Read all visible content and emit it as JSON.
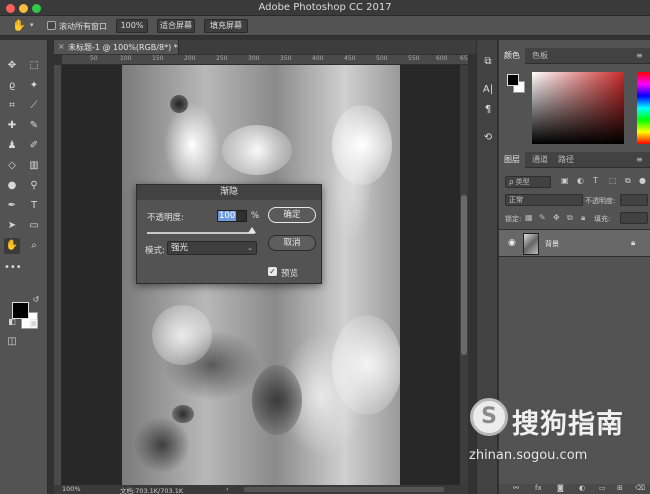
{
  "window": {
    "title": "Adobe Photoshop CC 2017"
  },
  "options": {
    "scroll_all_label": "滚动所有窗口",
    "btn_100": "100%",
    "btn_fit": "适合屏幕",
    "btn_fill": "填充屏幕"
  },
  "document": {
    "tab_close": "×",
    "tab_name": "未标题-1 @ 100%(RGB/8*) *"
  },
  "ruler": {
    "ticks": [
      "50",
      "100",
      "150",
      "200",
      "250",
      "300",
      "350",
      "400",
      "450",
      "500",
      "550",
      "600",
      "650"
    ]
  },
  "status": {
    "zoom": "100%",
    "doc": "文档:703.1K/703.1K",
    "caret": "›"
  },
  "color_panel": {
    "tab_color": "颜色",
    "tab_swatches": "色板"
  },
  "layers_panel": {
    "tab_layers": "图层",
    "tab_channels": "通道",
    "tab_paths": "路径",
    "filter_kind": "ρ 类型",
    "blend_mode": "正常",
    "opacity_label": "不透明度:",
    "lock_label": "锁定:",
    "fill_label": "填充:",
    "layer_name": "背景"
  },
  "dialog": {
    "title": "渐隐",
    "opacity_label": "不透明度:",
    "opacity_value": "100",
    "percent": "%",
    "mode_label": "模式:",
    "mode_value": "强光",
    "ok": "确定",
    "cancel": "取消",
    "preview_label": "预览"
  },
  "watermark": {
    "text": "搜狗指南",
    "url": "zhinan.sogou.com"
  },
  "colors": {
    "foreground": "#000000",
    "background": "#ffffff",
    "accent": "#c92a2a"
  }
}
